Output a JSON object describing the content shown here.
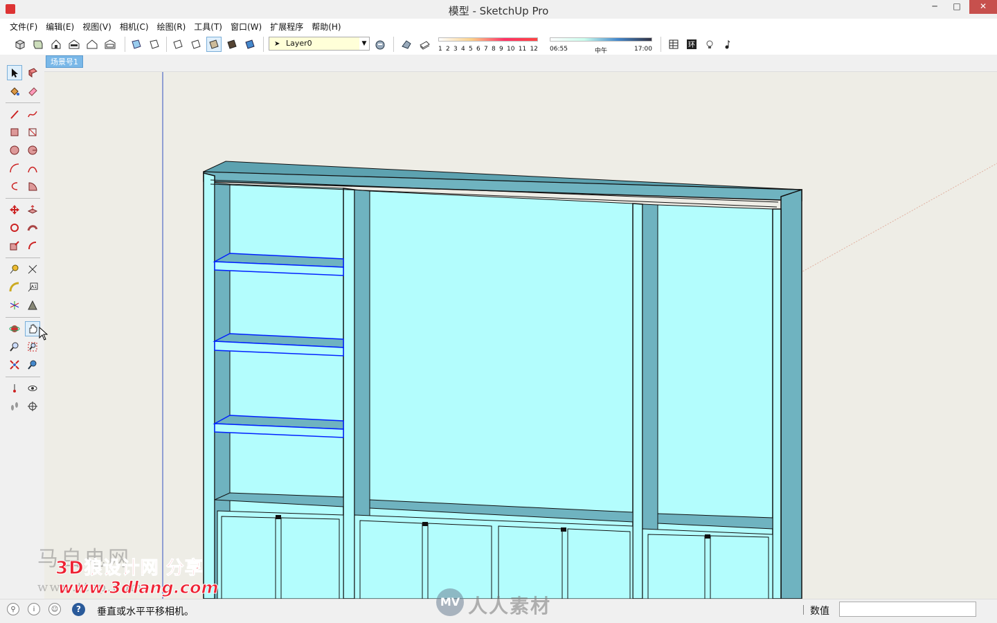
{
  "window": {
    "title": "模型 - SketchUp Pro",
    "minimize": "─",
    "maximize": "□",
    "close": "✕"
  },
  "menu": {
    "items": [
      "文件(F)",
      "编辑(E)",
      "视图(V)",
      "相机(C)",
      "绘图(R)",
      "工具(T)",
      "窗口(W)",
      "扩展程序",
      "帮助(H)"
    ]
  },
  "toolbar": {
    "layer_value": "Layer0",
    "shadow_months": [
      "1",
      "2",
      "3",
      "4",
      "5",
      "6",
      "7",
      "8",
      "9",
      "10",
      "11",
      "12"
    ],
    "time_start": "06:55",
    "time_mid": "中午",
    "time_end": "17:00"
  },
  "scenes": {
    "active_tab": "场景号1"
  },
  "left_tools": {
    "active_tool": "pan-tool"
  },
  "status": {
    "message": "垂直或水平平移相机。",
    "measurements_label": "数值",
    "measurements_value": "",
    "help_glyph": "?"
  },
  "watermarks": {
    "site_line": "3D狼设计网 分享",
    "url_line": "www.3dlang.com",
    "bg_line1": "马自电网",
    "bg_line2": "www.ttsp.com",
    "rr_logo": "MV",
    "rr_text": "人人素材"
  },
  "colors": {
    "accent_tab": "#7ab8e8",
    "model_face": "#b3fdfd",
    "model_side": "#6fb3c0",
    "selected_edge": "#0020ff",
    "viewport_bg": "#eeede6"
  }
}
